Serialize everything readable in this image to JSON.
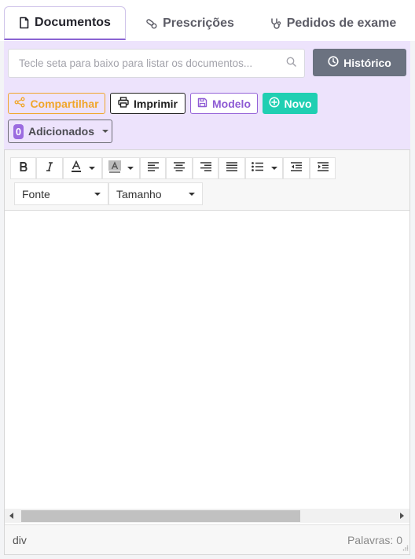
{
  "tabs": [
    {
      "label": "Documentos",
      "icon": "document-icon",
      "active": true
    },
    {
      "label": "Prescrições",
      "icon": "pills-icon",
      "active": false
    },
    {
      "label": "Pedidos de exame",
      "icon": "stethoscope-icon",
      "active": false
    }
  ],
  "search": {
    "placeholder": "Tecle seta para baixo para listar os documentos...",
    "value": ""
  },
  "historico": {
    "label": "Histórico"
  },
  "actions": {
    "share": "Compartilhar",
    "print": "Imprimir",
    "model": "Modelo",
    "new": "Novo"
  },
  "added": {
    "count": "0",
    "label": "Adicionados"
  },
  "editor": {
    "font_placeholder": "Fonte",
    "size_placeholder": "Tamanho",
    "path": "div",
    "word_count": "Palavras: 0"
  },
  "colors": {
    "accent": "#8a63d2",
    "panel_bg": "#ede3fc",
    "share": "#f0a62b",
    "new": "#20cfb2",
    "historico_bg": "#6b7280"
  }
}
